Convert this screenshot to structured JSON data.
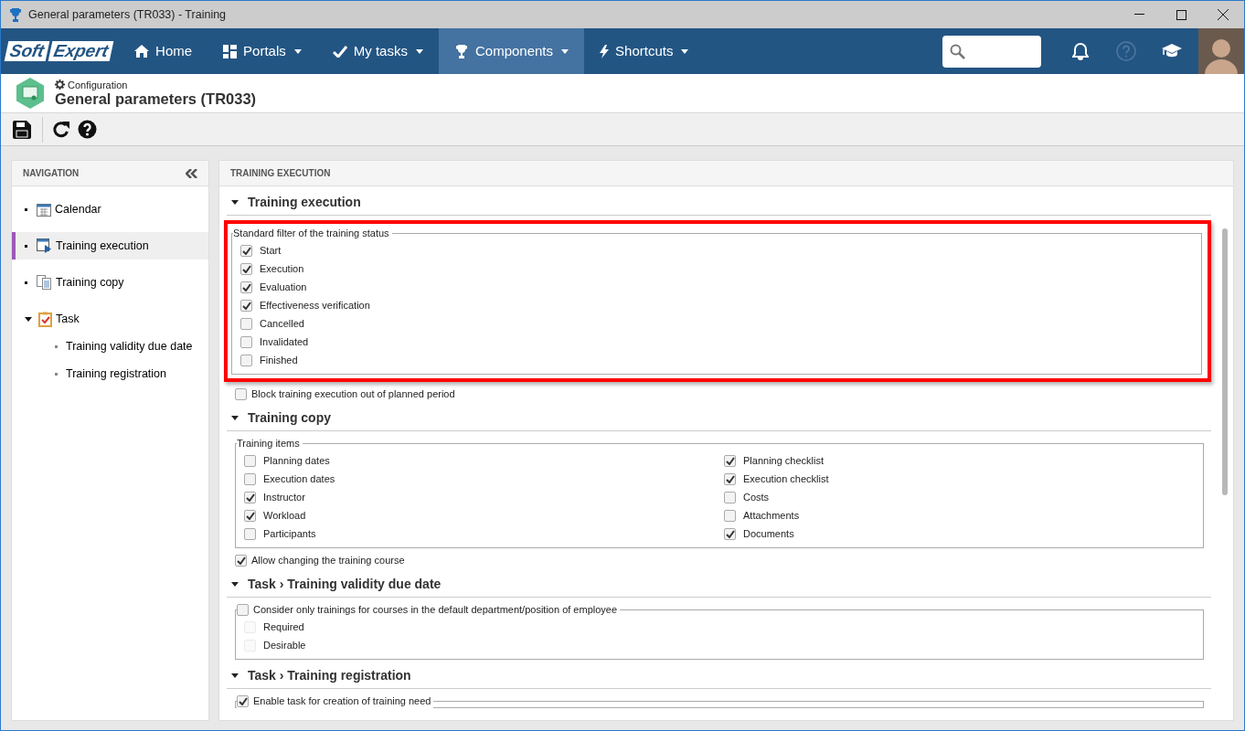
{
  "window": {
    "title": "General parameters (TR033) - Training"
  },
  "navbar": {
    "logo": [
      "Soft",
      "Expert"
    ],
    "menu": [
      {
        "label": "Home",
        "dropdown": false,
        "selected": false
      },
      {
        "label": "Portals",
        "dropdown": true,
        "selected": false
      },
      {
        "label": "My tasks",
        "dropdown": true,
        "selected": false
      },
      {
        "label": "Components",
        "dropdown": true,
        "selected": true
      },
      {
        "label": "Shortcuts",
        "dropdown": true,
        "selected": false
      }
    ],
    "help_disabled": true
  },
  "header": {
    "breadcrumb": "Configuration",
    "title": "General parameters (TR033)"
  },
  "navigation": {
    "title": "NAVIGATION",
    "items": [
      {
        "label": "Calendar",
        "selected": false
      },
      {
        "label": "Training execution",
        "selected": true
      },
      {
        "label": "Training copy",
        "selected": false
      },
      {
        "label": "Task",
        "selected": false,
        "expanded": true,
        "children": [
          {
            "label": "Training validity due date",
            "selected": false
          },
          {
            "label": "Training registration",
            "selected": false
          }
        ]
      }
    ]
  },
  "content": {
    "title": "TRAINING EXECUTION",
    "sections": [
      {
        "title": "Training execution",
        "groups": [
          {
            "legend": "Standard filter of the training status",
            "highlighted": true,
            "columns": [
              [
                {
                  "label": "Start",
                  "checked": true,
                  "disabled": false
                },
                {
                  "label": "Execution",
                  "checked": true,
                  "disabled": false
                },
                {
                  "label": "Evaluation",
                  "checked": true,
                  "disabled": false
                },
                {
                  "label": "Effectiveness verification",
                  "checked": true,
                  "disabled": false
                },
                {
                  "label": "Cancelled",
                  "checked": false,
                  "disabled": false
                },
                {
                  "label": "Invalidated",
                  "checked": false,
                  "disabled": false
                },
                {
                  "label": "Finished",
                  "checked": false,
                  "disabled": false
                }
              ]
            ]
          }
        ],
        "options": [
          {
            "label": "Block training execution out of planned period",
            "checked": false
          }
        ]
      },
      {
        "title": "Training copy",
        "groups": [
          {
            "legend": "Training items",
            "highlighted": false,
            "columns": [
              [
                {
                  "label": "Planning dates",
                  "checked": false,
                  "disabled": false
                },
                {
                  "label": "Execution dates",
                  "checked": false,
                  "disabled": false
                },
                {
                  "label": "Instructor",
                  "checked": true,
                  "disabled": false
                },
                {
                  "label": "Workload",
                  "checked": true,
                  "disabled": false
                },
                {
                  "label": "Participants",
                  "checked": false,
                  "disabled": false
                }
              ],
              [
                {
                  "label": "Planning checklist",
                  "checked": true,
                  "disabled": false
                },
                {
                  "label": "Execution checklist",
                  "checked": true,
                  "disabled": false
                },
                {
                  "label": "Costs",
                  "checked": false,
                  "disabled": false
                },
                {
                  "label": "Attachments",
                  "checked": false,
                  "disabled": false
                },
                {
                  "label": "Documents",
                  "checked": true,
                  "disabled": false
                }
              ]
            ]
          }
        ],
        "options": [
          {
            "label": "Allow changing the training course",
            "checked": true
          }
        ]
      },
      {
        "title": "Task › Training validity due date",
        "groups": [
          {
            "legend": "Consider only trainings for courses in the default department/position of employee",
            "legend_checked": false,
            "highlighted": false,
            "columns": [
              [
                {
                  "label": "Required",
                  "checked": false,
                  "disabled": true
                },
                {
                  "label": "Desirable",
                  "checked": false,
                  "disabled": true
                }
              ]
            ]
          }
        ]
      },
      {
        "title": "Task › Training registration",
        "groups": [
          {
            "legend": "Enable task for creation of training need",
            "legend_checked": true,
            "highlighted": false
          }
        ]
      }
    ]
  }
}
